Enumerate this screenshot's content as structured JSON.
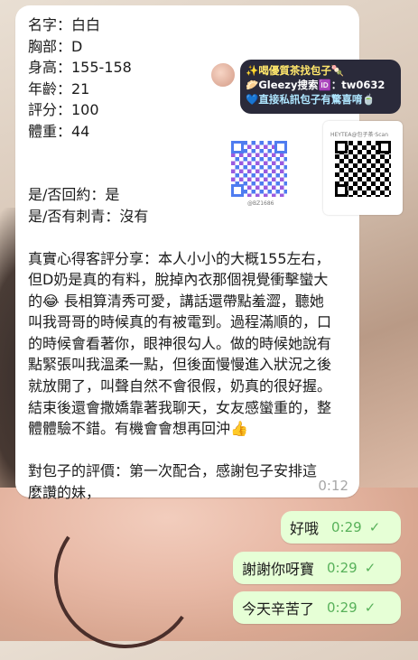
{
  "incoming": {
    "lines": [
      "名字：白白",
      "胸部：D",
      "身高：155-158",
      "年齡：21",
      "評分：100",
      "體重：44"
    ],
    "lines2": [
      "是/否回約：是",
      "是/否有刺青：沒有"
    ],
    "review_p1": "真實心得客評分享：本人小小的大概155左右，但D奶是真的有料，脫掉內衣那個視覺衝擊蠻大的",
    "review_emoji1": "😂",
    "review_p2": " 長相算清秀可愛，講話還帶點羞澀，聽她叫我哥哥的時候真的有被電到。過程滿順的，口的時候會看著你，眼神很勾人。做的時候她說有點緊張叫我溫柔一點，但後面慢慢進入狀況之後就放開了，叫聲自然不會很假，奶真的很好握。結束後還會撒嬌靠著我聊天，女友感蠻重的，整體體驗不錯。有機會會想再回沖",
    "review_emoji2": "👍",
    "review_p3": "對包子的評價：第一次配合，感謝包子安排這麼讚的妹，",
    "time": "0:12"
  },
  "promo": {
    "line1": "✨喝優質茶找包子🍡",
    "line2": "🥟Gleezy搜索🆔：tw0632",
    "line3": "💙直接私訊包子有驚喜唷🍵",
    "qr_left_caption": "@BZ1686",
    "qr_right_caption": "HEYTEA@包子茶·Scan"
  },
  "outgoing": [
    {
      "text": "好哦",
      "time": "0:29"
    },
    {
      "text": "謝謝你呀寶",
      "time": "0:29"
    },
    {
      "text": "今天辛苦了",
      "time": "0:29"
    }
  ],
  "icons": {
    "read_check": "✓"
  }
}
